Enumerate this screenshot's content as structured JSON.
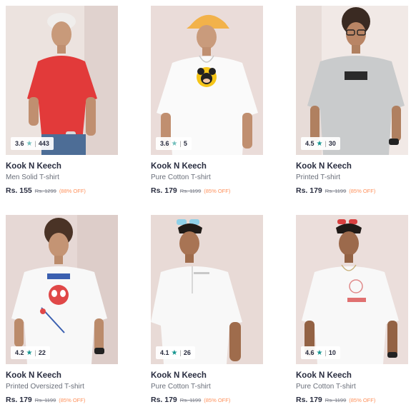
{
  "products": [
    {
      "brand": "Kook N Keech",
      "description": "Men Solid T-shirt",
      "price": "Rs. 155",
      "mrp": "Rs. 1299",
      "discount": "(88% OFF)",
      "rating": "3.6",
      "rating_count": "443",
      "shirt_color": "#e23a3a",
      "bg_color": "#ece3df"
    },
    {
      "brand": "Kook N Keech",
      "description": "Pure Cotton T-shirt",
      "price": "Rs. 179",
      "mrp": "Rs. 1199",
      "discount": "(85% OFF)",
      "rating": "3.6",
      "rating_count": "5",
      "shirt_color": "#fafafa",
      "bg_color": "#eadcd9"
    },
    {
      "brand": "Kook N Keech",
      "description": "Printed T-shirt",
      "price": "Rs. 179",
      "mrp": "Rs. 1199",
      "discount": "(85% OFF)",
      "rating": "4.5",
      "rating_count": "30",
      "shirt_color": "#c9cbcc",
      "bg_color": "#f1e9e6"
    },
    {
      "brand": "Kook N Keech",
      "description": "Printed Oversized T-shirt",
      "price": "Rs. 179",
      "mrp": "Rs. 1199",
      "discount": "(85% OFF)",
      "rating": "4.2",
      "rating_count": "22",
      "shirt_color": "#f8f8f8",
      "bg_color": "#e6d8d5"
    },
    {
      "brand": "Kook N Keech",
      "description": "Pure Cotton T-shirt",
      "price": "Rs. 179",
      "mrp": "Rs. 1199",
      "discount": "(85% OFF)",
      "rating": "4.1",
      "rating_count": "26",
      "shirt_color": "#f8f8f8",
      "bg_color": "#e8dad6"
    },
    {
      "brand": "Kook N Keech",
      "description": "Pure Cotton T-shirt",
      "price": "Rs. 179",
      "mrp": "Rs. 1199",
      "discount": "(85% OFF)",
      "rating": "4.6",
      "rating_count": "10",
      "shirt_color": "#f8f8f8",
      "bg_color": "#ebdedb"
    }
  ],
  "icons": {
    "rating_star": "star-icon"
  }
}
